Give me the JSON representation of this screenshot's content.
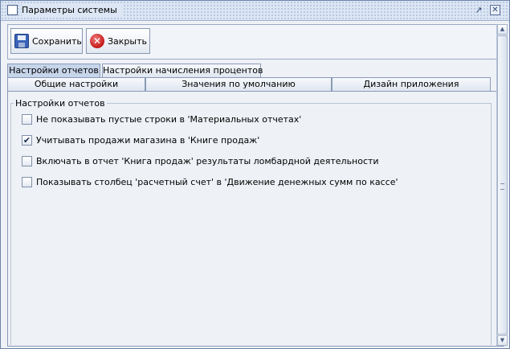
{
  "window": {
    "title": "Параметры системы"
  },
  "toolbar": {
    "save_label": "Сохранить",
    "close_label": "Закрыть"
  },
  "tabs": {
    "row_top": [
      {
        "label": "Настройки отчетов",
        "selected": true
      },
      {
        "label": "Настройки начисления процентов",
        "selected": false
      }
    ],
    "row_bottom": [
      {
        "label": "Общие настройки"
      },
      {
        "label": "Значения по умолчанию"
      },
      {
        "label": "Дизайн приложения"
      }
    ]
  },
  "panel": {
    "group_title": "Настройки отчетов",
    "options": [
      {
        "label": "Не показывать пустые строки в 'Материальных отчетах'",
        "checked": false
      },
      {
        "label": "Учитывать продажи магазина в 'Книге продаж'",
        "checked": true
      },
      {
        "label": "Включать в отчет 'Книга продаж' результаты ломбардной деятельности",
        "checked": false
      },
      {
        "label": "Показывать столбец 'расчетный счет' в 'Движение денежных сумм по кассе'",
        "checked": false
      }
    ]
  },
  "icons": {
    "window": "window-icon",
    "maximize": "maximize-icon",
    "close": "close-icon",
    "save": "floppy-disk-icon",
    "close_action": "red-x-icon"
  },
  "colors": {
    "title_bar": "#dce6f4",
    "selected_tab": "#c7d5ea",
    "close_button": "#c41818"
  }
}
